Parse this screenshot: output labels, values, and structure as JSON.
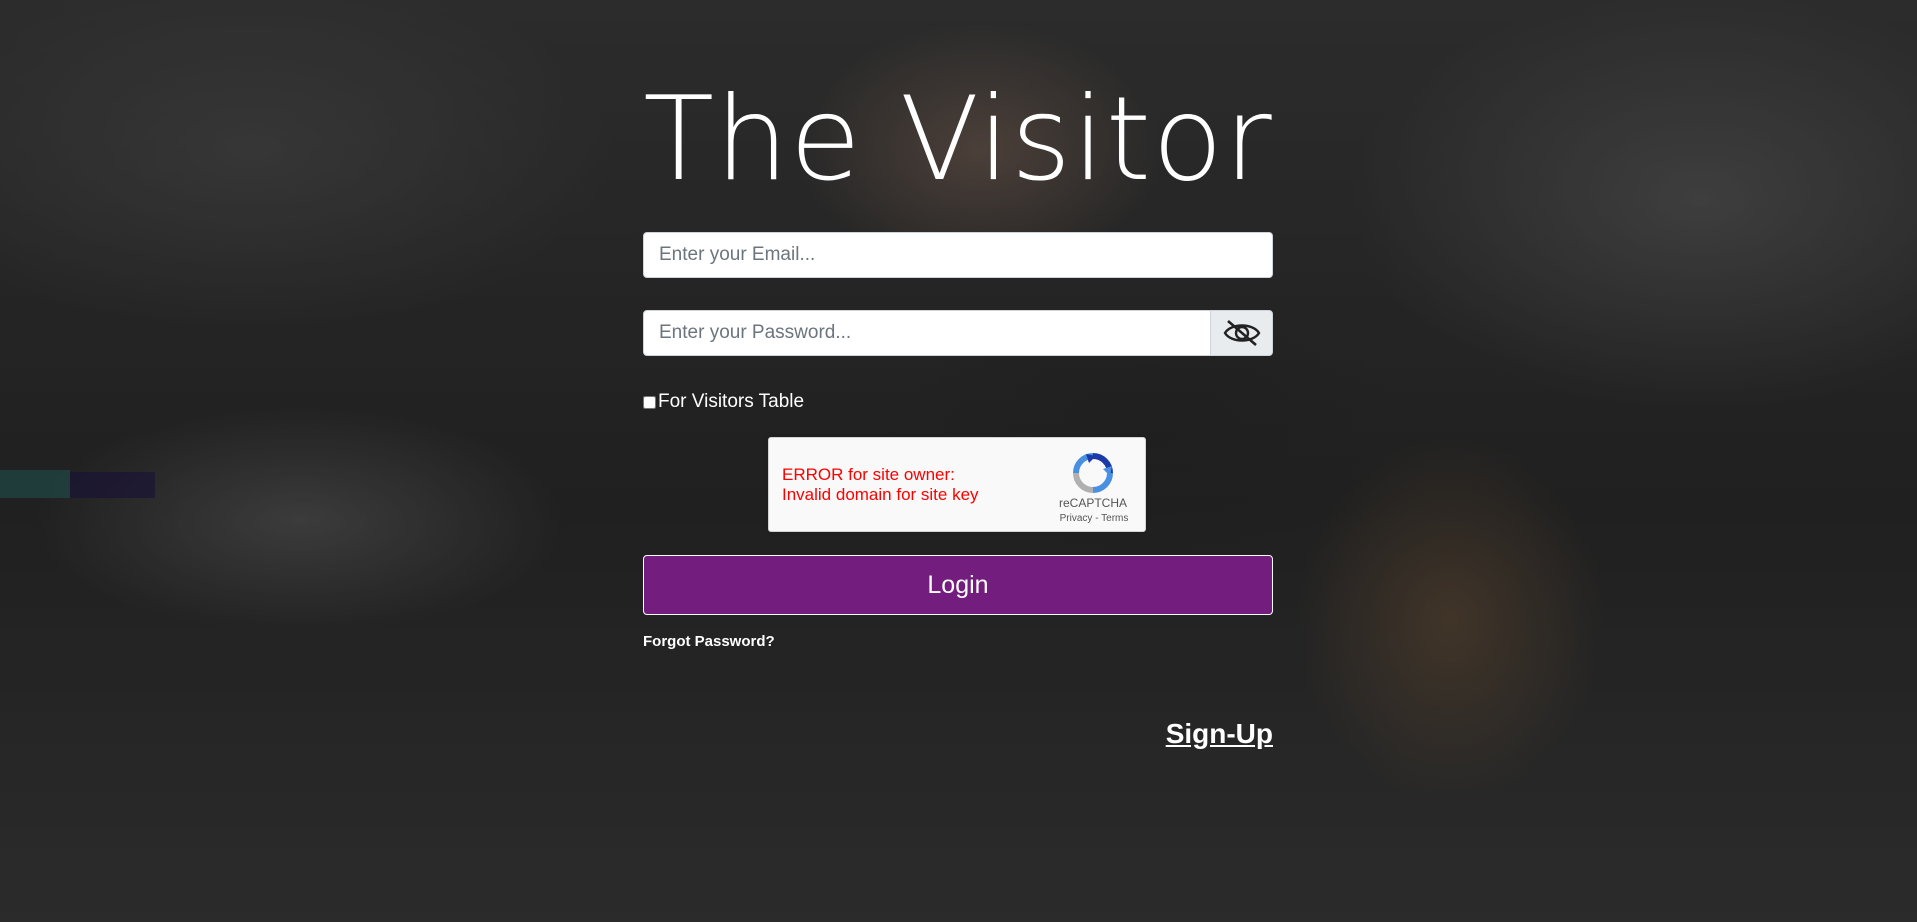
{
  "app": {
    "title": "The Visitor"
  },
  "form": {
    "email_placeholder": "Enter your Email...",
    "email_value": "",
    "password_placeholder": "Enter your Password...",
    "password_value": "",
    "password_toggle_icon": "eye-slash-icon",
    "checkbox_label": "For Visitors Table",
    "checkbox_checked": false,
    "login_label": "Login",
    "forgot_label": "Forgot Password?",
    "signup_label": "Sign-Up"
  },
  "recaptcha": {
    "error_line1": "ERROR for site owner:",
    "error_line2": "Invalid domain for site key",
    "brand": "reCAPTCHA",
    "links": "Privacy - Terms",
    "error_color": "#ff0000"
  },
  "colors": {
    "login_button": "#731e7e",
    "text": "#ffffff"
  }
}
